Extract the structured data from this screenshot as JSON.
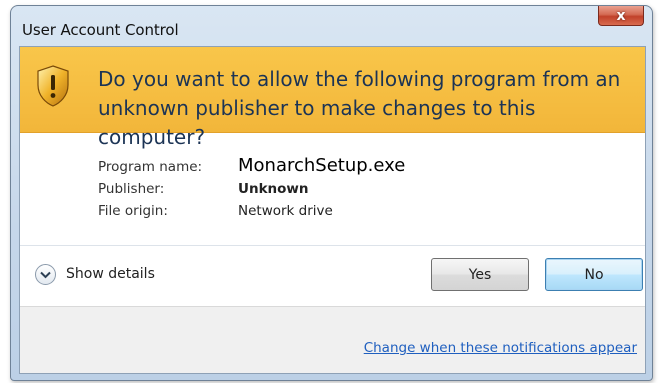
{
  "window": {
    "title": "User Account Control",
    "close_glyph": "x"
  },
  "banner": {
    "question": "Do you want to allow the following program from an unknown publisher to make changes to this computer?",
    "icon": "warning-shield-icon",
    "color": "#f4b93c"
  },
  "info": {
    "program_label": "Program name:",
    "program_value": "MonarchSetup.exe",
    "publisher_label": "Publisher:",
    "publisher_value": "Unknown",
    "origin_label": "File origin:",
    "origin_value": "Network drive"
  },
  "details": {
    "show_details_label": "Show details",
    "chevron_icon": "chevron-down-icon"
  },
  "buttons": {
    "yes_label": "Yes",
    "no_label": "No"
  },
  "footer": {
    "link_text": "Change when these notifications appear"
  },
  "colors": {
    "link": "#1f5fbf",
    "title_text": "#1c3455",
    "close_red": "#c1412a"
  }
}
